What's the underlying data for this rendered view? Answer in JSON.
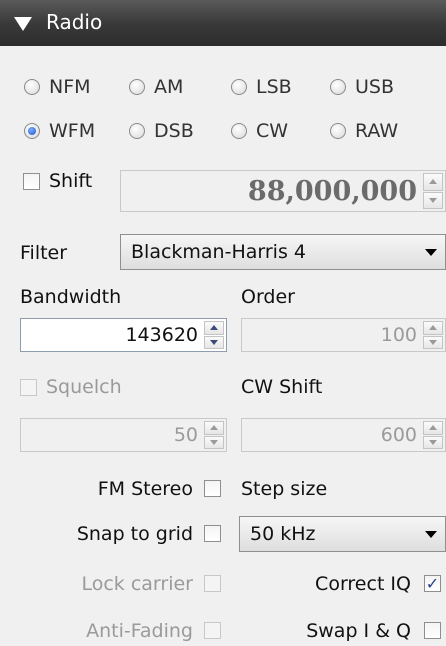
{
  "header": {
    "title": "Radio"
  },
  "modes": [
    {
      "label": "NFM",
      "selected": false
    },
    {
      "label": "AM",
      "selected": false
    },
    {
      "label": "LSB",
      "selected": false
    },
    {
      "label": "USB",
      "selected": false
    },
    {
      "label": "WFM",
      "selected": true
    },
    {
      "label": "DSB",
      "selected": false
    },
    {
      "label": "CW",
      "selected": false
    },
    {
      "label": "RAW",
      "selected": false
    }
  ],
  "shift": {
    "label": "Shift",
    "checked": false,
    "value": "88,000,000"
  },
  "filter": {
    "label": "Filter",
    "value": "Blackman-Harris 4"
  },
  "bandwidth": {
    "label": "Bandwidth",
    "value": "143620"
  },
  "order": {
    "label": "Order",
    "value": "100"
  },
  "squelch": {
    "label": "Squelch",
    "checked": false,
    "value": "50"
  },
  "cw_shift": {
    "label": "CW Shift",
    "value": "600"
  },
  "fm_stereo": {
    "label": "FM Stereo",
    "checked": false
  },
  "step_size": {
    "label": "Step size",
    "value": "50 kHz"
  },
  "snap_to_grid": {
    "label": "Snap to grid",
    "checked": false
  },
  "lock_carrier": {
    "label": "Lock carrier",
    "checked": false
  },
  "correct_iq": {
    "label": "Correct IQ",
    "checked": true
  },
  "anti_fading": {
    "label": "Anti-Fading",
    "checked": false
  },
  "swap_iq": {
    "label": "Swap I & Q",
    "checked": false
  }
}
